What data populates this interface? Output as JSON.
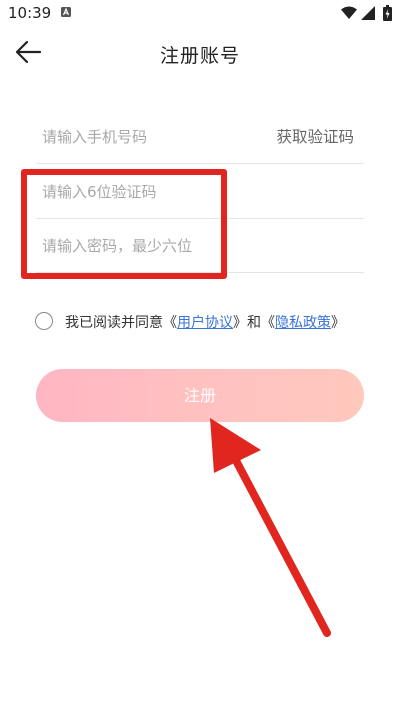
{
  "status_bar": {
    "time": "10:39"
  },
  "header": {
    "title": "注册账号"
  },
  "form": {
    "phone_placeholder": "请输入手机号码",
    "get_code_label": "获取验证码",
    "code_placeholder": "请输入6位验证码",
    "password_placeholder": "请输入密码，最少六位"
  },
  "agreement": {
    "prefix": "我已阅读并同意《",
    "user_agreement": "用户协议",
    "middle": "》和《",
    "privacy_policy": "隐私政策",
    "suffix": "》"
  },
  "register_button_label": "注册",
  "colors": {
    "link": "#3b74d9",
    "highlight": "#e1261f",
    "button_gradient_start": "#ffb6c3",
    "button_gradient_end": "#ffc8bd"
  },
  "icons": [
    "app-notification-icon",
    "wifi-icon",
    "signal-icon",
    "battery-icon",
    "back-arrow-icon"
  ]
}
